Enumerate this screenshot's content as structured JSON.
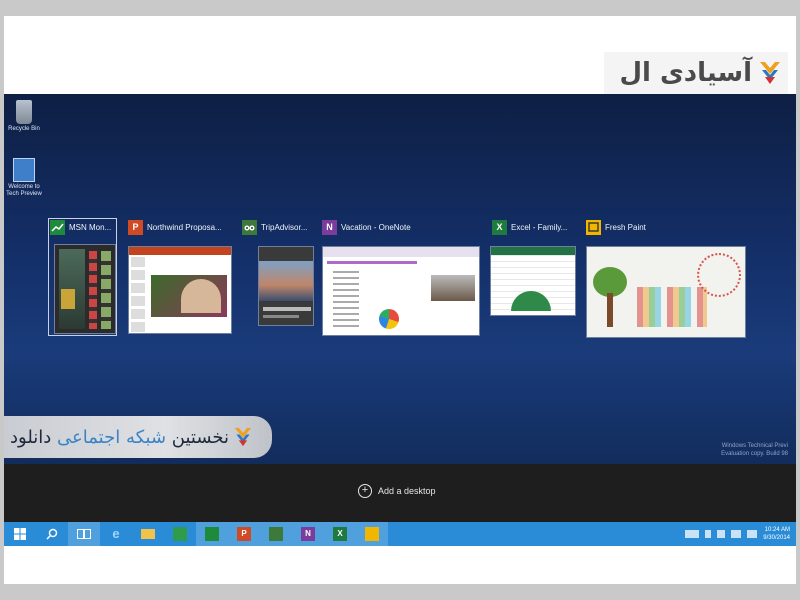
{
  "watermark": {
    "logo_text": "آسیادی ال",
    "banner_text_main": "نخستین",
    "banner_text_accent": " شبکه اجتماعی",
    "banner_text_end": " دانلود"
  },
  "desktop_icons": [
    {
      "label": "Recycle Bin"
    },
    {
      "label": "Welcome to Tech Preview"
    }
  ],
  "windows": [
    {
      "title": "MSN Mon...",
      "icon": "msn-money-icon",
      "color": "#1e8a3c"
    },
    {
      "title": "Northwind Proposa...",
      "icon": "powerpoint-icon",
      "color": "#d04a25",
      "glyph": "P"
    },
    {
      "title": "TripAdvisor...",
      "icon": "tripadvisor-icon",
      "color": "#3d7a3a"
    },
    {
      "title": "Vacation - OneNote",
      "icon": "onenote-icon",
      "color": "#7b3c9c",
      "glyph": "N"
    },
    {
      "title": "Excel - Family...",
      "icon": "excel-icon",
      "color": "#1f7a40",
      "glyph": "X"
    },
    {
      "title": "Fresh Paint",
      "icon": "fresh-paint-icon",
      "color": "#f1b600"
    }
  ],
  "build_watermark": {
    "line1": "Windows Technical Previ",
    "line2": "Evaluation copy. Build 98"
  },
  "task_view": {
    "add_desktop_label": "Add a desktop"
  },
  "clock": {
    "time": "10:24 AM",
    "date": "9/30/2014"
  },
  "colors": {
    "taskbar": "#2a8cd6",
    "desktop": "#14306a",
    "taskview_bar": "#1e1e1e"
  }
}
